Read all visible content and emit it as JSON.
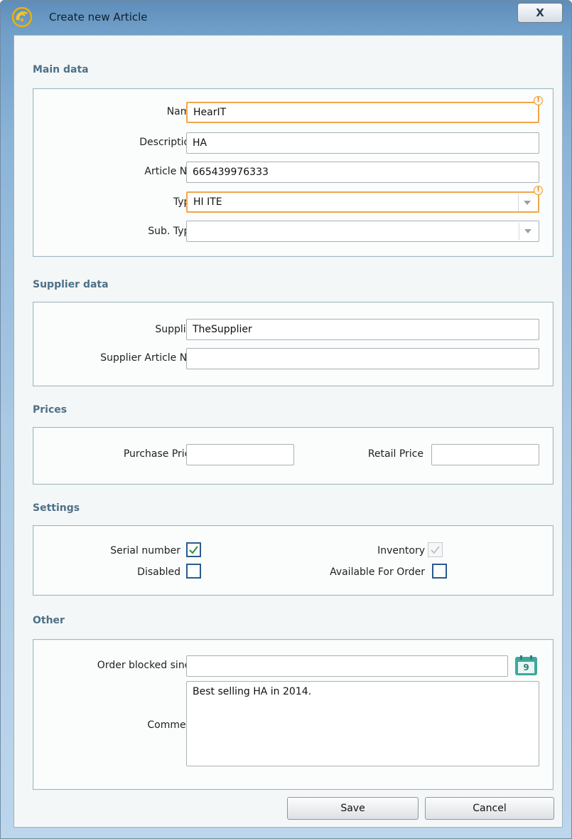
{
  "window": {
    "title": "Create new Article",
    "close_label": "X"
  },
  "main_data": {
    "header": "Main data",
    "name": {
      "label": "Name",
      "value": "HearIT"
    },
    "description": {
      "label": "Description",
      "value": "HA"
    },
    "article_no": {
      "label": "Article No.",
      "value": "665439976333"
    },
    "type": {
      "label": "Type",
      "value": "HI ITE"
    },
    "sub_type": {
      "label": "Sub. Type",
      "value": ""
    }
  },
  "supplier_data": {
    "header": "Supplier data",
    "supplier": {
      "label": "Supplier",
      "value": "TheSupplier"
    },
    "supplier_article_no": {
      "label": "Supplier Article No.",
      "value": ""
    }
  },
  "prices": {
    "header": "Prices",
    "purchase_price": {
      "label": "Purchase Price",
      "value": ""
    },
    "retail_price": {
      "label": "Retail Price",
      "value": ""
    }
  },
  "settings": {
    "header": "Settings",
    "serial_number": {
      "label": "Serial number",
      "checked": true
    },
    "inventory": {
      "label": "Inventory",
      "checked": true,
      "enabled": false
    },
    "disabled": {
      "label": "Disabled",
      "checked": false
    },
    "available_for_order": {
      "label": "Available For Order",
      "checked": false
    }
  },
  "other": {
    "header": "Other",
    "order_blocked_since": {
      "label": "Order blocked since",
      "value": ""
    },
    "comment": {
      "label": "Comment",
      "value": "Best selling HA in 2014."
    }
  },
  "buttons": {
    "save": "Save",
    "cancel": "Cancel"
  },
  "calendar_icon_text": "9",
  "colors": {
    "section_header": "#4d7088",
    "required_border": "#f2a64a",
    "checkbox_border": "#2a5b8c",
    "check_mark": "#2f9a3c"
  }
}
